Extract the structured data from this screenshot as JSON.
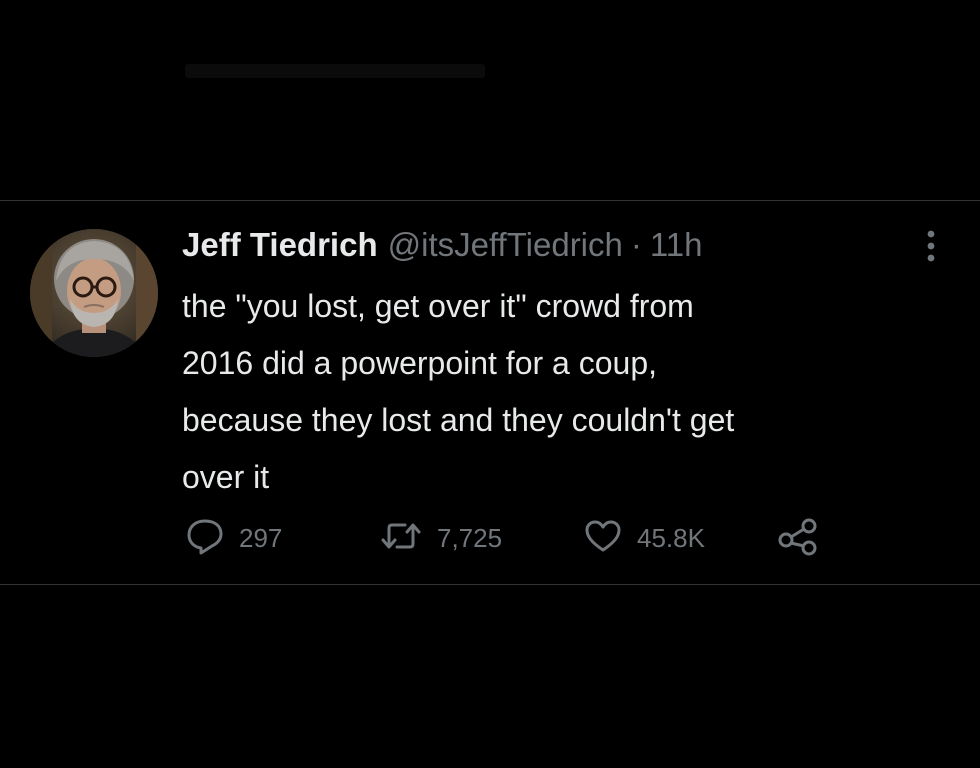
{
  "tweet": {
    "display_name": "Jeff Tiedrich",
    "handle": "@itsJeffTiedrich",
    "separator": "·",
    "time": "11h",
    "text_lines": [
      "the \"you lost, get over it\" crowd from",
      "2016 did a powerpoint for a coup,",
      "because they lost and they couldn't get",
      "over it"
    ],
    "actions": {
      "reply_count": "297",
      "retweet_count": "7,725",
      "like_count": "45.8K"
    },
    "icons": {
      "reply": "reply-icon",
      "retweet": "retweet-icon",
      "like": "heart-icon",
      "share": "share-icon",
      "more": "more-options-icon"
    }
  },
  "colors": {
    "background": "#000000",
    "primary_text": "#e7e9ea",
    "secondary_text": "#71767b",
    "divider": "#2f3336"
  }
}
